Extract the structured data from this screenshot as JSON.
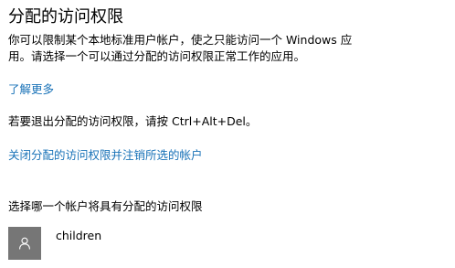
{
  "page": {
    "title": "分配的访问权限",
    "description_line1": "你可以限制某个本地标准用户帐户，使之只能访问一个 Windows 应",
    "description_line2": "用。请选择一个可以通过分配的访问权限正常工作的应用。",
    "learn_more_link": "了解更多",
    "exit_hint": "若要退出分配的访问权限，请按 Ctrl+Alt+Del。",
    "turn_off_link": "关闭分配的访问权限并注销所选的帐户",
    "choose_account_heading": "选择哪一个帐户将具有分配的访问权限"
  },
  "account": {
    "name": "children",
    "avatar_icon": "user-icon"
  },
  "colors": {
    "link": "#1a73b8",
    "avatar_bg": "#767676",
    "text": "#000000",
    "background": "#ffffff"
  }
}
